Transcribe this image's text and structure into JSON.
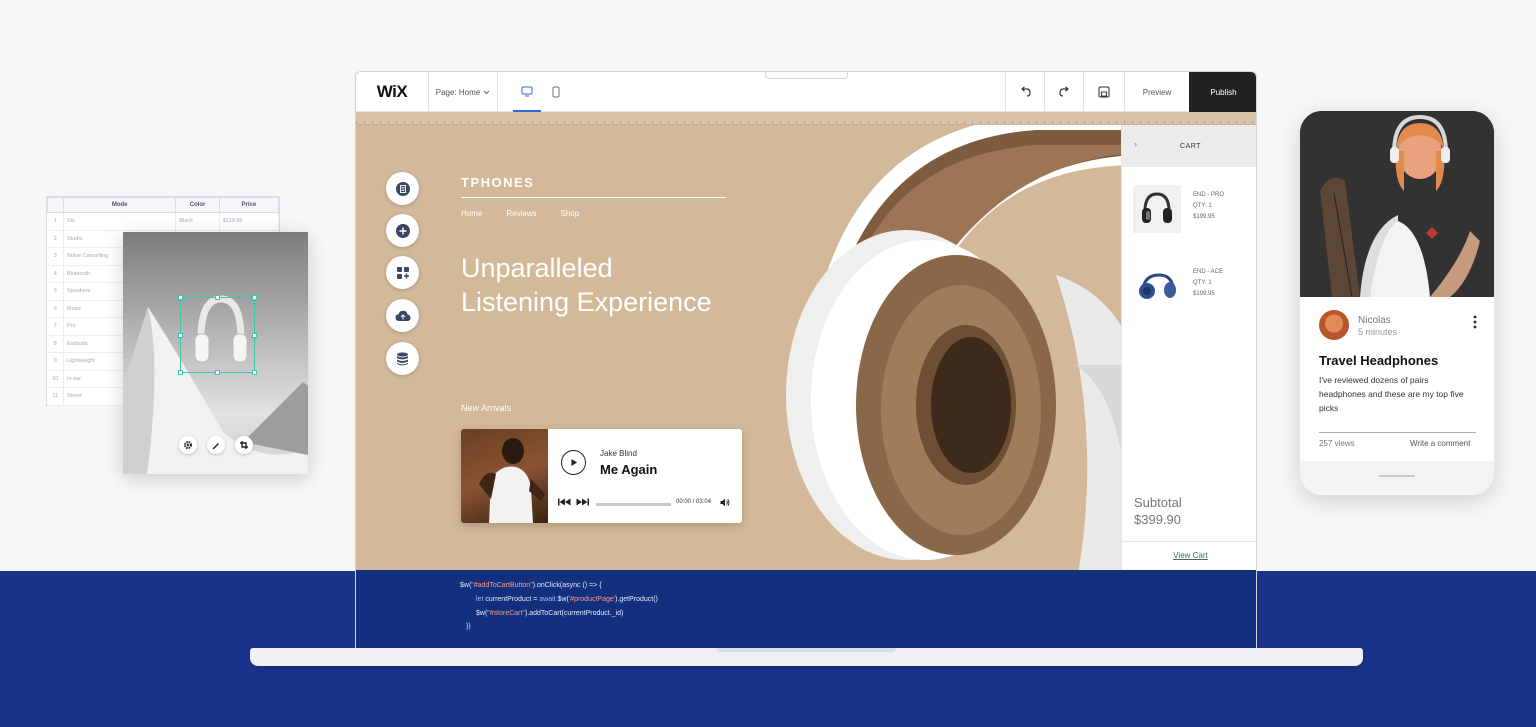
{
  "table": {
    "headers": [
      "Mode",
      "Color",
      "Price"
    ],
    "rows": [
      {
        "num": "1",
        "mode": "Ski",
        "color": "Black",
        "price": "$129.95"
      },
      {
        "num": "2",
        "mode": "Studio",
        "color": "",
        "price": ""
      },
      {
        "num": "3",
        "mode": "Noise Cancelling",
        "color": "",
        "price": ""
      },
      {
        "num": "4",
        "mode": "Bluetooth",
        "color": "",
        "price": ""
      },
      {
        "num": "5",
        "mode": "Speakers",
        "color": "",
        "price": ""
      },
      {
        "num": "6",
        "mode": "Music",
        "color": "",
        "price": ""
      },
      {
        "num": "7",
        "mode": "Pro",
        "color": "",
        "price": ""
      },
      {
        "num": "8",
        "mode": "Earbuds",
        "color": "",
        "price": ""
      },
      {
        "num": "9",
        "mode": "Lightweight",
        "color": "",
        "price": ""
      },
      {
        "num": "10",
        "mode": "In ear",
        "color": "",
        "price": ""
      },
      {
        "num": "11",
        "mode": "Street",
        "color": "",
        "price": ""
      }
    ]
  },
  "image_editor": {
    "tools": [
      "settings-icon",
      "pen-icon",
      "crop-icon"
    ]
  },
  "editor": {
    "logo": "WiX",
    "page_select": "Page: Home",
    "devices": [
      "desktop-icon",
      "mobile-icon"
    ],
    "active_device": "desktop",
    "actions": [
      "undo-icon",
      "redo-icon",
      "save-icon"
    ],
    "preview_label": "Preview",
    "publish_label": "Publish"
  },
  "site": {
    "brand": "TPHONES",
    "nav": [
      "Home",
      "Reviews",
      "Shop"
    ],
    "headline_line1": "Unparalleled",
    "headline_line2": "Listening Experience",
    "new_arrivals": "New Arrivals",
    "side_tools": [
      "page-icon",
      "add-icon",
      "apps-icon",
      "upload-cloud-icon",
      "database-icon"
    ]
  },
  "player": {
    "artist": "Jake Blind",
    "song": "Me Again",
    "time": "00:00 / 03:04",
    "progress": 0
  },
  "cart": {
    "title": "CART",
    "items": [
      {
        "name": "END - PRO",
        "qty": "QTY: 1",
        "price": "$199.95"
      },
      {
        "name": "END - ACE",
        "qty": "QTY: 1",
        "price": "$199.95"
      }
    ],
    "subtotal_label": "Subtotal",
    "subtotal_value": "$399.90",
    "view_cart": "View Cart"
  },
  "code": {
    "line1_a": "$w(",
    "line1_str": "\"#addToCartButton\"",
    "line1_b": ").onClick(async () => {",
    "line2_kw1": "let",
    "line2_a": " currentProduct = ",
    "line2_kw2": "await",
    "line2_b": " $w(",
    "line2_str": "'#productPage'",
    "line2_c": ").getProduct()",
    "line3_a": "$w(",
    "line3_str": "\"#storeCart\"",
    "line3_b": ").addToCart(currentProduct._id)",
    "line4": "})"
  },
  "phone": {
    "author": "Nicolas",
    "ago": "5 minutes",
    "title": "Travel Headphones",
    "excerpt": "I've reviewed dozens of pairs headphones and these are my top five picks",
    "views": "257 views",
    "comment": "Write a comment"
  },
  "colors": {
    "band": "#1a3289",
    "canvas": "#d3b999",
    "publish": "#222222",
    "selection": "#3ec7a8"
  }
}
